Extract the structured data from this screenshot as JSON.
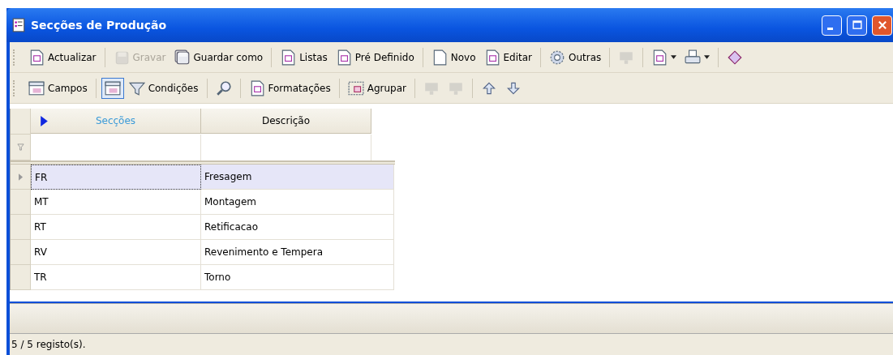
{
  "window": {
    "title": "Secções de Produção"
  },
  "toolbars": [
    [
      {
        "kind": "button",
        "label": "Actualizar",
        "disabled": false,
        "pressed": false
      },
      {
        "kind": "separator"
      },
      {
        "kind": "button",
        "label": "Gravar",
        "disabled": true,
        "pressed": false
      },
      {
        "kind": "button",
        "label": "Guardar como",
        "disabled": false,
        "pressed": false
      },
      {
        "kind": "separator"
      },
      {
        "kind": "button",
        "label": "Listas",
        "disabled": false,
        "pressed": false
      },
      {
        "kind": "button",
        "label": "Pré Definido",
        "disabled": false,
        "pressed": false
      },
      {
        "kind": "separator"
      },
      {
        "kind": "button",
        "label": "Novo",
        "disabled": false,
        "pressed": false
      },
      {
        "kind": "button",
        "label": "Editar",
        "disabled": false,
        "pressed": false
      },
      {
        "kind": "separator"
      },
      {
        "kind": "button",
        "label": "Outras",
        "disabled": false,
        "pressed": false
      },
      {
        "kind": "separator"
      },
      {
        "kind": "icon",
        "disabled": true,
        "pressed": false
      },
      {
        "kind": "separator"
      },
      {
        "kind": "dropdown",
        "disabled": false,
        "pressed": false
      },
      {
        "kind": "dropdown",
        "disabled": false,
        "pressed": false
      },
      {
        "kind": "separator"
      },
      {
        "kind": "icon",
        "disabled": false,
        "pressed": false
      }
    ],
    [
      {
        "kind": "button",
        "label": "Campos",
        "disabled": false,
        "pressed": false
      },
      {
        "kind": "separator"
      },
      {
        "kind": "icon",
        "disabled": false,
        "pressed": true
      },
      {
        "kind": "button",
        "label": "Condições",
        "disabled": false,
        "pressed": false
      },
      {
        "kind": "separator"
      },
      {
        "kind": "icon",
        "disabled": false,
        "pressed": false
      },
      {
        "kind": "separator"
      },
      {
        "kind": "button",
        "label": "Formatações",
        "disabled": false,
        "pressed": false
      },
      {
        "kind": "separator"
      },
      {
        "kind": "button",
        "label": "Agrupar",
        "disabled": false,
        "pressed": false
      },
      {
        "kind": "separator"
      },
      {
        "kind": "icon",
        "disabled": true,
        "pressed": false
      },
      {
        "kind": "icon",
        "disabled": true,
        "pressed": false
      },
      {
        "kind": "separator"
      },
      {
        "kind": "icon",
        "disabled": false,
        "pressed": false
      },
      {
        "kind": "icon",
        "disabled": false,
        "pressed": false
      }
    ]
  ],
  "table": {
    "columns": [
      {
        "label": "Secções",
        "sorted": true
      },
      {
        "label": "Descrição",
        "sorted": false
      }
    ],
    "rows": [
      {
        "cells": [
          "FR",
          "Fresagem"
        ],
        "selected": true
      },
      {
        "cells": [
          "MT",
          "Montagem"
        ],
        "selected": false
      },
      {
        "cells": [
          "RT",
          "Retificacao"
        ],
        "selected": false
      },
      {
        "cells": [
          "RV",
          "Revenimento e Tempera"
        ],
        "selected": false
      },
      {
        "cells": [
          "TR",
          "Torno"
        ],
        "selected": false
      }
    ]
  },
  "status_bar": {
    "text": "5 / 5 registo(s)."
  }
}
